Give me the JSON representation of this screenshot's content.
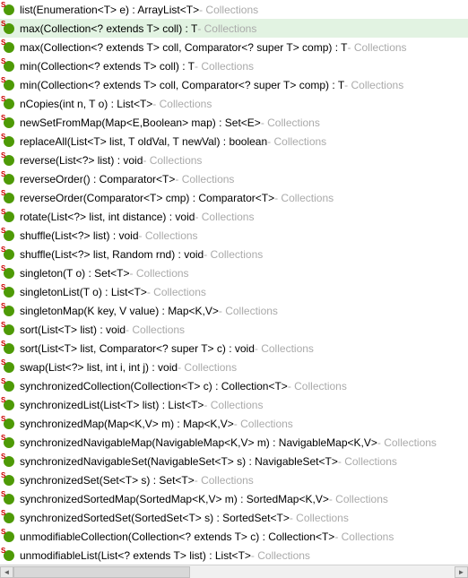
{
  "source_label": "Collections",
  "separator": " - ",
  "selected_index": 1,
  "badge_s": "S",
  "items": [
    {
      "sig": "list(Enumeration<T> e) : ArrayList<T>",
      "static": true
    },
    {
      "sig": "max(Collection<? extends T> coll) : T",
      "static": true
    },
    {
      "sig": "max(Collection<? extends T> coll, Comparator<? super T> comp) : T",
      "static": true
    },
    {
      "sig": "min(Collection<? extends T> coll) : T",
      "static": true
    },
    {
      "sig": "min(Collection<? extends T> coll, Comparator<? super T> comp) : T",
      "static": true
    },
    {
      "sig": "nCopies(int n, T o) : List<T>",
      "static": true
    },
    {
      "sig": "newSetFromMap(Map<E,Boolean> map) : Set<E>",
      "static": true
    },
    {
      "sig": "replaceAll(List<T> list, T oldVal, T newVal) : boolean",
      "static": true
    },
    {
      "sig": "reverse(List<?> list) : void",
      "static": true
    },
    {
      "sig": "reverseOrder() : Comparator<T>",
      "static": true
    },
    {
      "sig": "reverseOrder(Comparator<T> cmp) : Comparator<T>",
      "static": true
    },
    {
      "sig": "rotate(List<?> list, int distance) : void",
      "static": true
    },
    {
      "sig": "shuffle(List<?> list) : void",
      "static": true
    },
    {
      "sig": "shuffle(List<?> list, Random rnd) : void",
      "static": true
    },
    {
      "sig": "singleton(T o) : Set<T>",
      "static": true
    },
    {
      "sig": "singletonList(T o) : List<T>",
      "static": true
    },
    {
      "sig": "singletonMap(K key, V value) : Map<K,V>",
      "static": true
    },
    {
      "sig": "sort(List<T> list) : void",
      "static": true
    },
    {
      "sig": "sort(List<T> list, Comparator<? super T> c) : void",
      "static": true
    },
    {
      "sig": "swap(List<?> list, int i, int j) : void",
      "static": true
    },
    {
      "sig": "synchronizedCollection(Collection<T> c) : Collection<T>",
      "static": true
    },
    {
      "sig": "synchronizedList(List<T> list) : List<T>",
      "static": true
    },
    {
      "sig": "synchronizedMap(Map<K,V> m) : Map<K,V>",
      "static": true
    },
    {
      "sig": "synchronizedNavigableMap(NavigableMap<K,V> m) : NavigableMap<K,V>",
      "static": true
    },
    {
      "sig": "synchronizedNavigableSet(NavigableSet<T> s) : NavigableSet<T>",
      "static": true
    },
    {
      "sig": "synchronizedSet(Set<T> s) : Set<T>",
      "static": true
    },
    {
      "sig": "synchronizedSortedMap(SortedMap<K,V> m) : SortedMap<K,V>",
      "static": true
    },
    {
      "sig": "synchronizedSortedSet(SortedSet<T> s) : SortedSet<T>",
      "static": true
    },
    {
      "sig": "unmodifiableCollection(Collection<? extends T> c) : Collection<T>",
      "static": true
    },
    {
      "sig": "unmodifiableList(List<? extends T> list) : List<T>",
      "static": true
    }
  ],
  "arrows": {
    "left": "◄",
    "right": "►"
  }
}
